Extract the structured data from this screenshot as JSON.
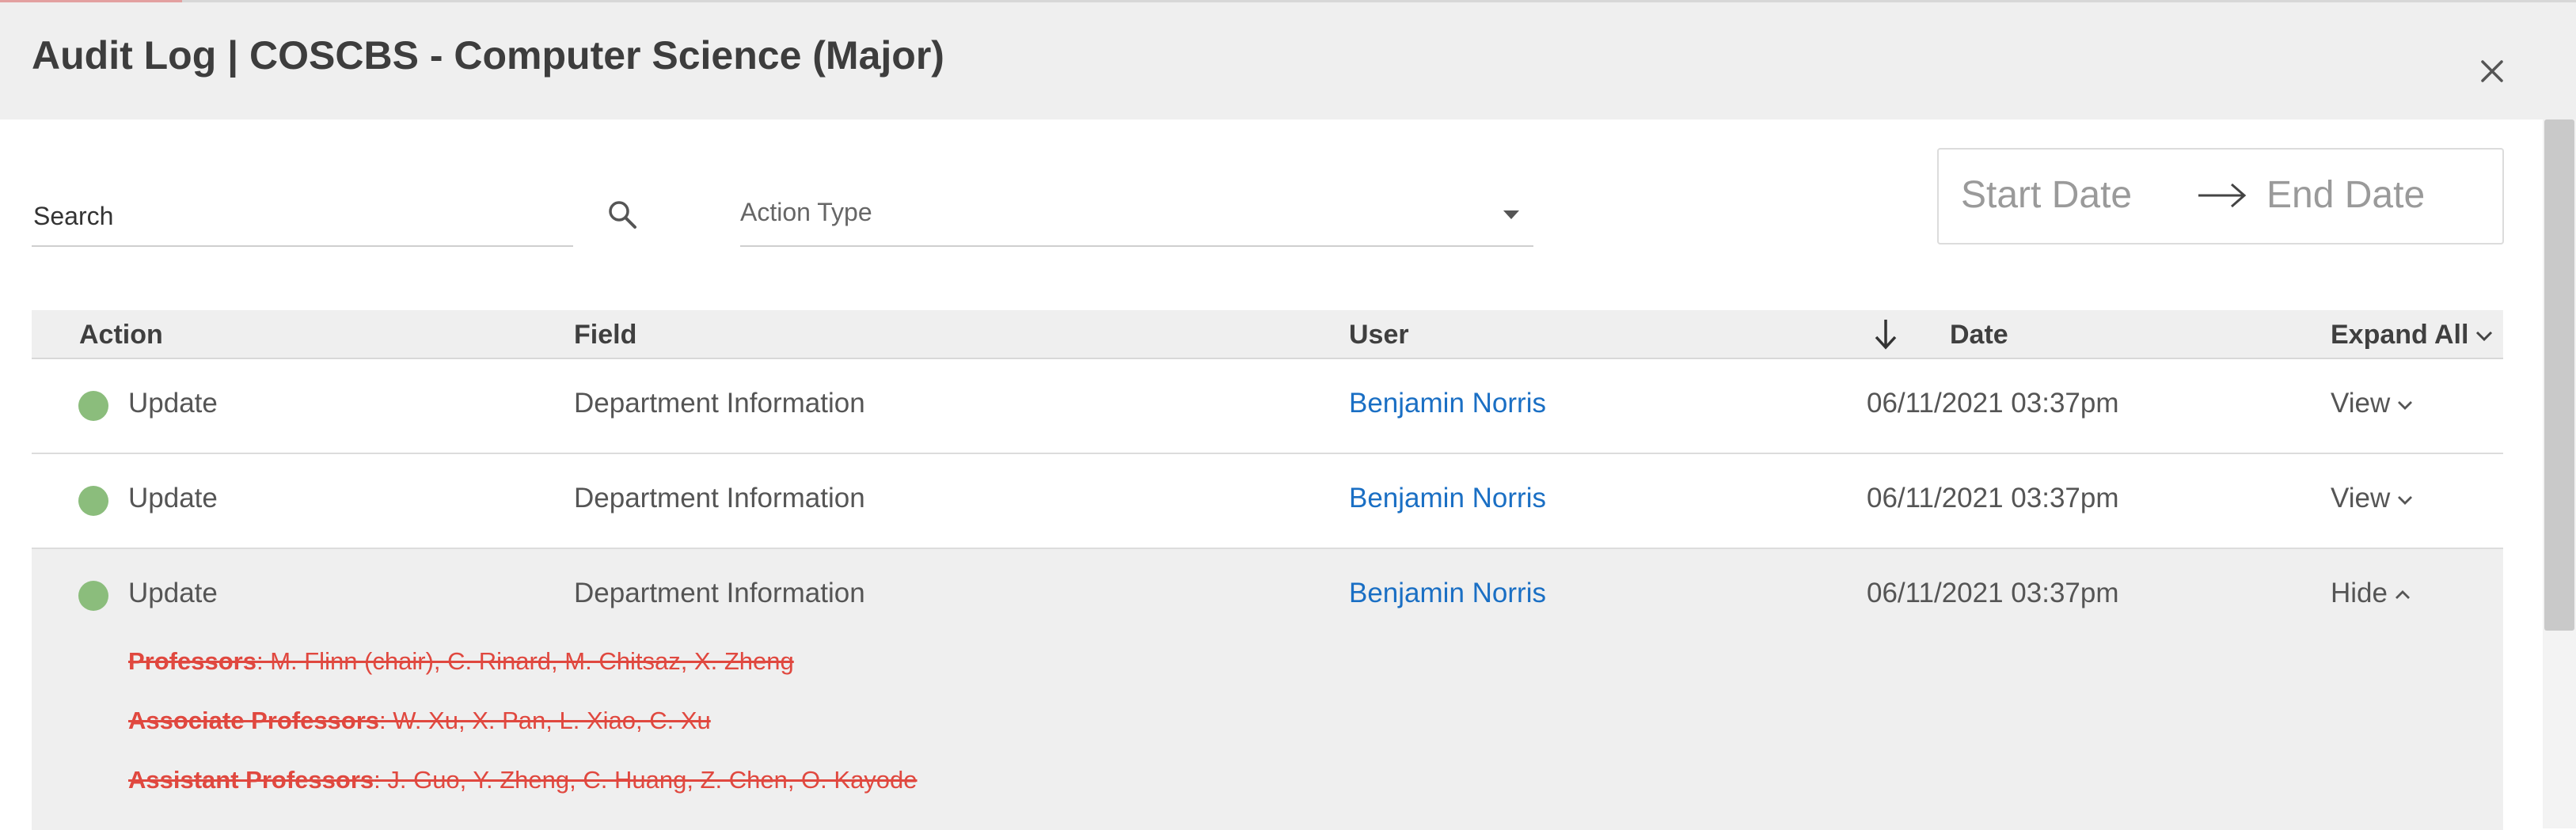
{
  "modal": {
    "title": "Audit Log | COSCBS - Computer Science (Major)"
  },
  "filters": {
    "search_placeholder": "Search",
    "action_type_label": "Action Type",
    "start_date": "Start Date",
    "end_date": "End Date"
  },
  "table": {
    "headers": {
      "action": "Action",
      "field": "Field",
      "user": "User",
      "date": "Date",
      "expand_all": "Expand All"
    },
    "rows": [
      {
        "action": "Update",
        "field": "Department Information",
        "user": "Benjamin Norris",
        "date": "06/11/2021 03:37pm",
        "toggle": "View"
      },
      {
        "action": "Update",
        "field": "Department Information",
        "user": "Benjamin Norris",
        "date": "06/11/2021 03:37pm",
        "toggle": "View"
      },
      {
        "action": "Update",
        "field": "Department Information",
        "user": "Benjamin Norris",
        "date": "06/11/2021 03:37pm",
        "toggle": "Hide",
        "changes": [
          {
            "label": "Professors",
            "value": ": M. Flinn (chair), C. Rinard, M. Chitsaz, X. Zheng"
          },
          {
            "label": "Associate Professors",
            "value": ": W. Xu, X. Pan, L. Xiao, C. Xu"
          },
          {
            "label": "Assistant Professors",
            "value": ": J. Guo, Y. Zheng, C. Huang, Z. Chen, O. Kayode"
          }
        ]
      }
    ]
  },
  "colors": {
    "status_dot": "#8bbd7c",
    "user_link": "#1a6fc4",
    "removed_text": "#e0483f",
    "header_bg": "#efefef"
  },
  "icons": [
    "close-icon",
    "search-icon",
    "caret-down-icon",
    "arrow-right-icon",
    "sort-down-icon",
    "chevron-down-icon",
    "chevron-up-icon"
  ]
}
